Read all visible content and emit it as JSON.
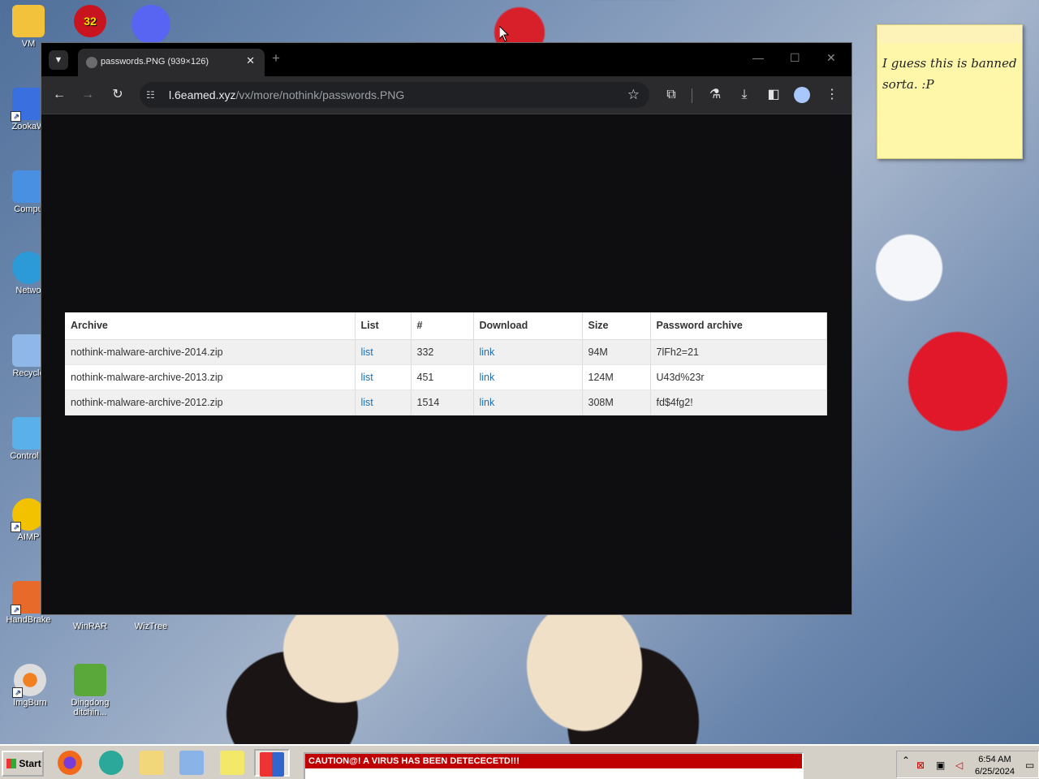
{
  "desktop": {
    "icons_left": [
      {
        "label": "VM",
        "icon": "folder-user-icon",
        "color": "#f3c23c"
      },
      {
        "label": "ZookaW",
        "icon": "zookaware-icon",
        "color": "#3a6fe0"
      },
      {
        "label": "Compu",
        "icon": "computer-icon",
        "color": "#4a90e2"
      },
      {
        "label": "Netwo",
        "icon": "network-globe-icon",
        "color": "#2d9ad8"
      },
      {
        "label": "Recycle",
        "icon": "recycle-bin-icon",
        "color": "#8fb8e8"
      },
      {
        "label": "Control F",
        "icon": "control-panel-icon",
        "color": "#5ab0e8"
      },
      {
        "label": "AIMP",
        "icon": "aimp-icon",
        "color": "#f2c200"
      },
      {
        "label": "HandBrake",
        "icon": "handbrake-icon",
        "color": "#e86a2a"
      }
    ],
    "icons_other": [
      {
        "label": "WinRAR",
        "icon": "winrar-icon",
        "color": "#8a4a9a"
      },
      {
        "label": "WizTree",
        "icon": "wiztree-icon",
        "color": "#3aa0d8"
      },
      {
        "label": "ImgBurn",
        "icon": "imgburn-icon",
        "color": "#f08020"
      },
      {
        "label": "Dingdong ditchin...",
        "icon": "dingdong-icon",
        "color": "#5aa83a"
      }
    ],
    "badge_count": "32"
  },
  "browser": {
    "tab_title": "passwords.PNG (939×126)",
    "url_host": "l.6eamed.xyz",
    "url_path": "/vx/more/nothink/passwords.PNG"
  },
  "table": {
    "headers": [
      "Archive",
      "List",
      "#",
      "Download",
      "Size",
      "Password archive"
    ],
    "rows": [
      [
        "nothink-malware-archive-2014.zip",
        "list",
        "332",
        "link",
        "94M",
        "7lFh2=21"
      ],
      [
        "nothink-malware-archive-2013.zip",
        "list",
        "451",
        "link",
        "124M",
        "U43d%23r"
      ],
      [
        "nothink-malware-archive-2012.zip",
        "list",
        "1514",
        "link",
        "308M",
        "fd$4fg2!"
      ]
    ]
  },
  "sticky_note": {
    "line1": "I guess this is banned",
    "line2": "sorta. :P"
  },
  "taskbar": {
    "start_label": "Start",
    "alert_text": "CAUTION@! A VIRUS HAS BEEN DETECECETD!!!",
    "clock_time": "6:54 AM",
    "clock_date": "6/25/2024"
  }
}
